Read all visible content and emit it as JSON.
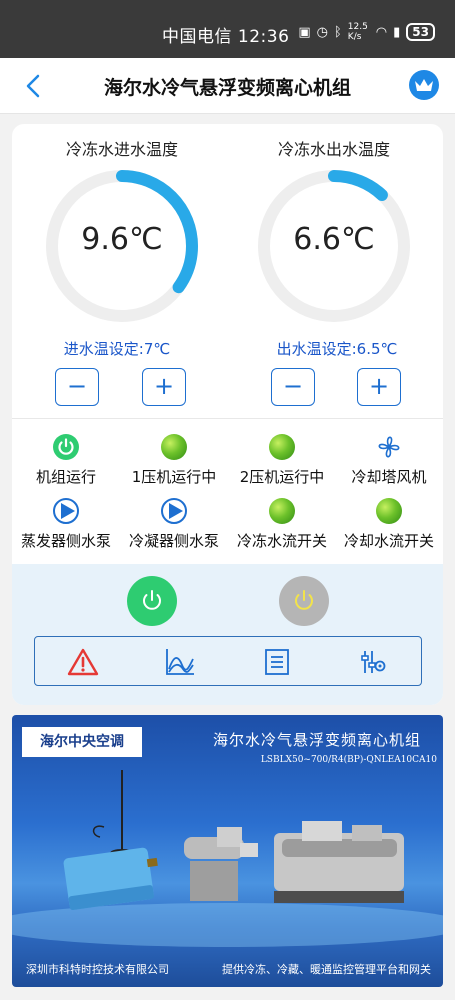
{
  "statusbar": {
    "time": "中国电信 12:36",
    "speed": "12.5 K/s",
    "battery": "53"
  },
  "navbar": {
    "title": "海尔水冷气悬浮变频离心机组"
  },
  "gauges": [
    {
      "title": "冷冻水进水温度",
      "value": "9.6℃",
      "level": 0.35,
      "setpoint": "进水温设定:7℃"
    },
    {
      "title": "冷冻水出水温度",
      "value": "6.6℃",
      "level": 0.12,
      "setpoint": "出水温设定:6.5℃"
    }
  ],
  "stepper": {
    "minus": "−",
    "plus": "+"
  },
  "status": [
    {
      "label": "机组运行",
      "icon": "power-on-icon"
    },
    {
      "label": "1压机运行中",
      "icon": "green-indicator-icon"
    },
    {
      "label": "2压机运行中",
      "icon": "green-indicator-icon"
    },
    {
      "label": "冷却塔风机",
      "icon": "fan-icon"
    },
    {
      "label": "蒸发器侧水泵",
      "icon": "pump-icon"
    },
    {
      "label": "冷凝器侧水泵",
      "icon": "pump-icon"
    },
    {
      "label": "冷冻水流开关",
      "icon": "green-indicator-icon"
    },
    {
      "label": "冷却水流开关",
      "icon": "green-indicator-icon"
    }
  ],
  "colors": {
    "accent": "#1e88e5",
    "gauge_arc": "#29a9e8",
    "power_on": "#2ecc71",
    "power_off": "#b5b5b5",
    "setpoint_text": "#1a56c9"
  },
  "banner": {
    "logo": "海尔中央空调",
    "title": "海尔水冷气悬浮变频离心机组",
    "model": "LSBLX50~700/R4(BP)-QNLEA10CA10",
    "footer_left": "深圳市科特时控技术有限公司",
    "footer_right": "提供冷冻、冷藏、暖通监控管理平台和网关"
  }
}
